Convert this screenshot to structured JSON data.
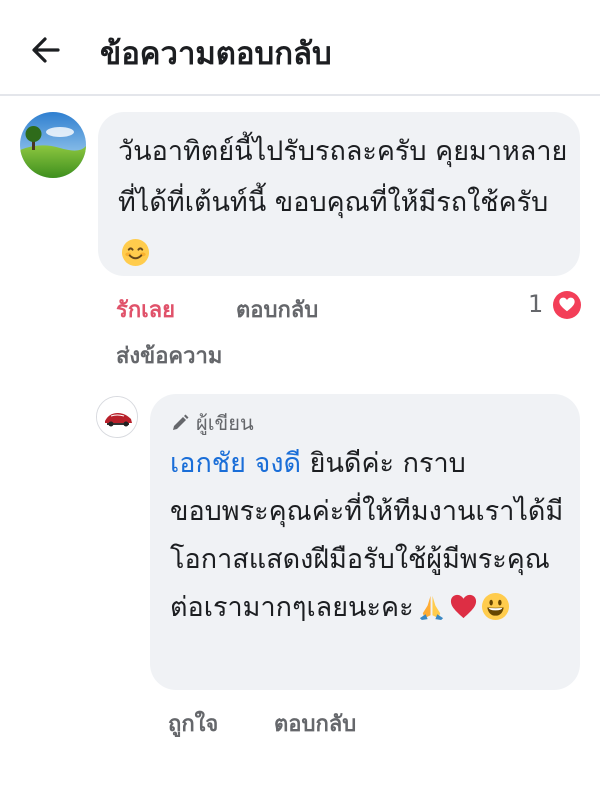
{
  "header": {
    "title": "ข้อความตอบกลับ"
  },
  "comment": {
    "text": "วันอาทิตย์นี้ไปรับรถละครับ คุยมาหลายที่ได้ที่เต้นท์นี้  ขอบคุณที่ให้มีรถใช้ครับ",
    "text_emoji": "smiling-face-icon",
    "actions": {
      "love_label": "รักเลย",
      "reply_label": "ตอบกลับ",
      "send_label": "ส่งข้อความ"
    },
    "reaction_count": "1",
    "reaction_type": "heart-icon",
    "colors": {
      "love": "#e0526a",
      "heart": "#f33e58"
    }
  },
  "reply": {
    "author_badge": "ผู้เขียน",
    "mention": "เอกชัย จงดี",
    "text": " ยินดีค่ะ กราบขอบพระคุณค่ะที่ให้ทีมงานเราได้มีโอกาสแสดงฝีมือรับใช้ผู้มีพระคุณต่อเรามากๆเลยนะคะ",
    "text_emojis": [
      "folded-hands-icon",
      "red-heart-icon",
      "grinning-face-icon"
    ],
    "actions": {
      "like_label": "ถูกใจ",
      "reply_label": "ตอบกลับ"
    },
    "colors": {
      "mention": "#1a6ed8"
    }
  }
}
